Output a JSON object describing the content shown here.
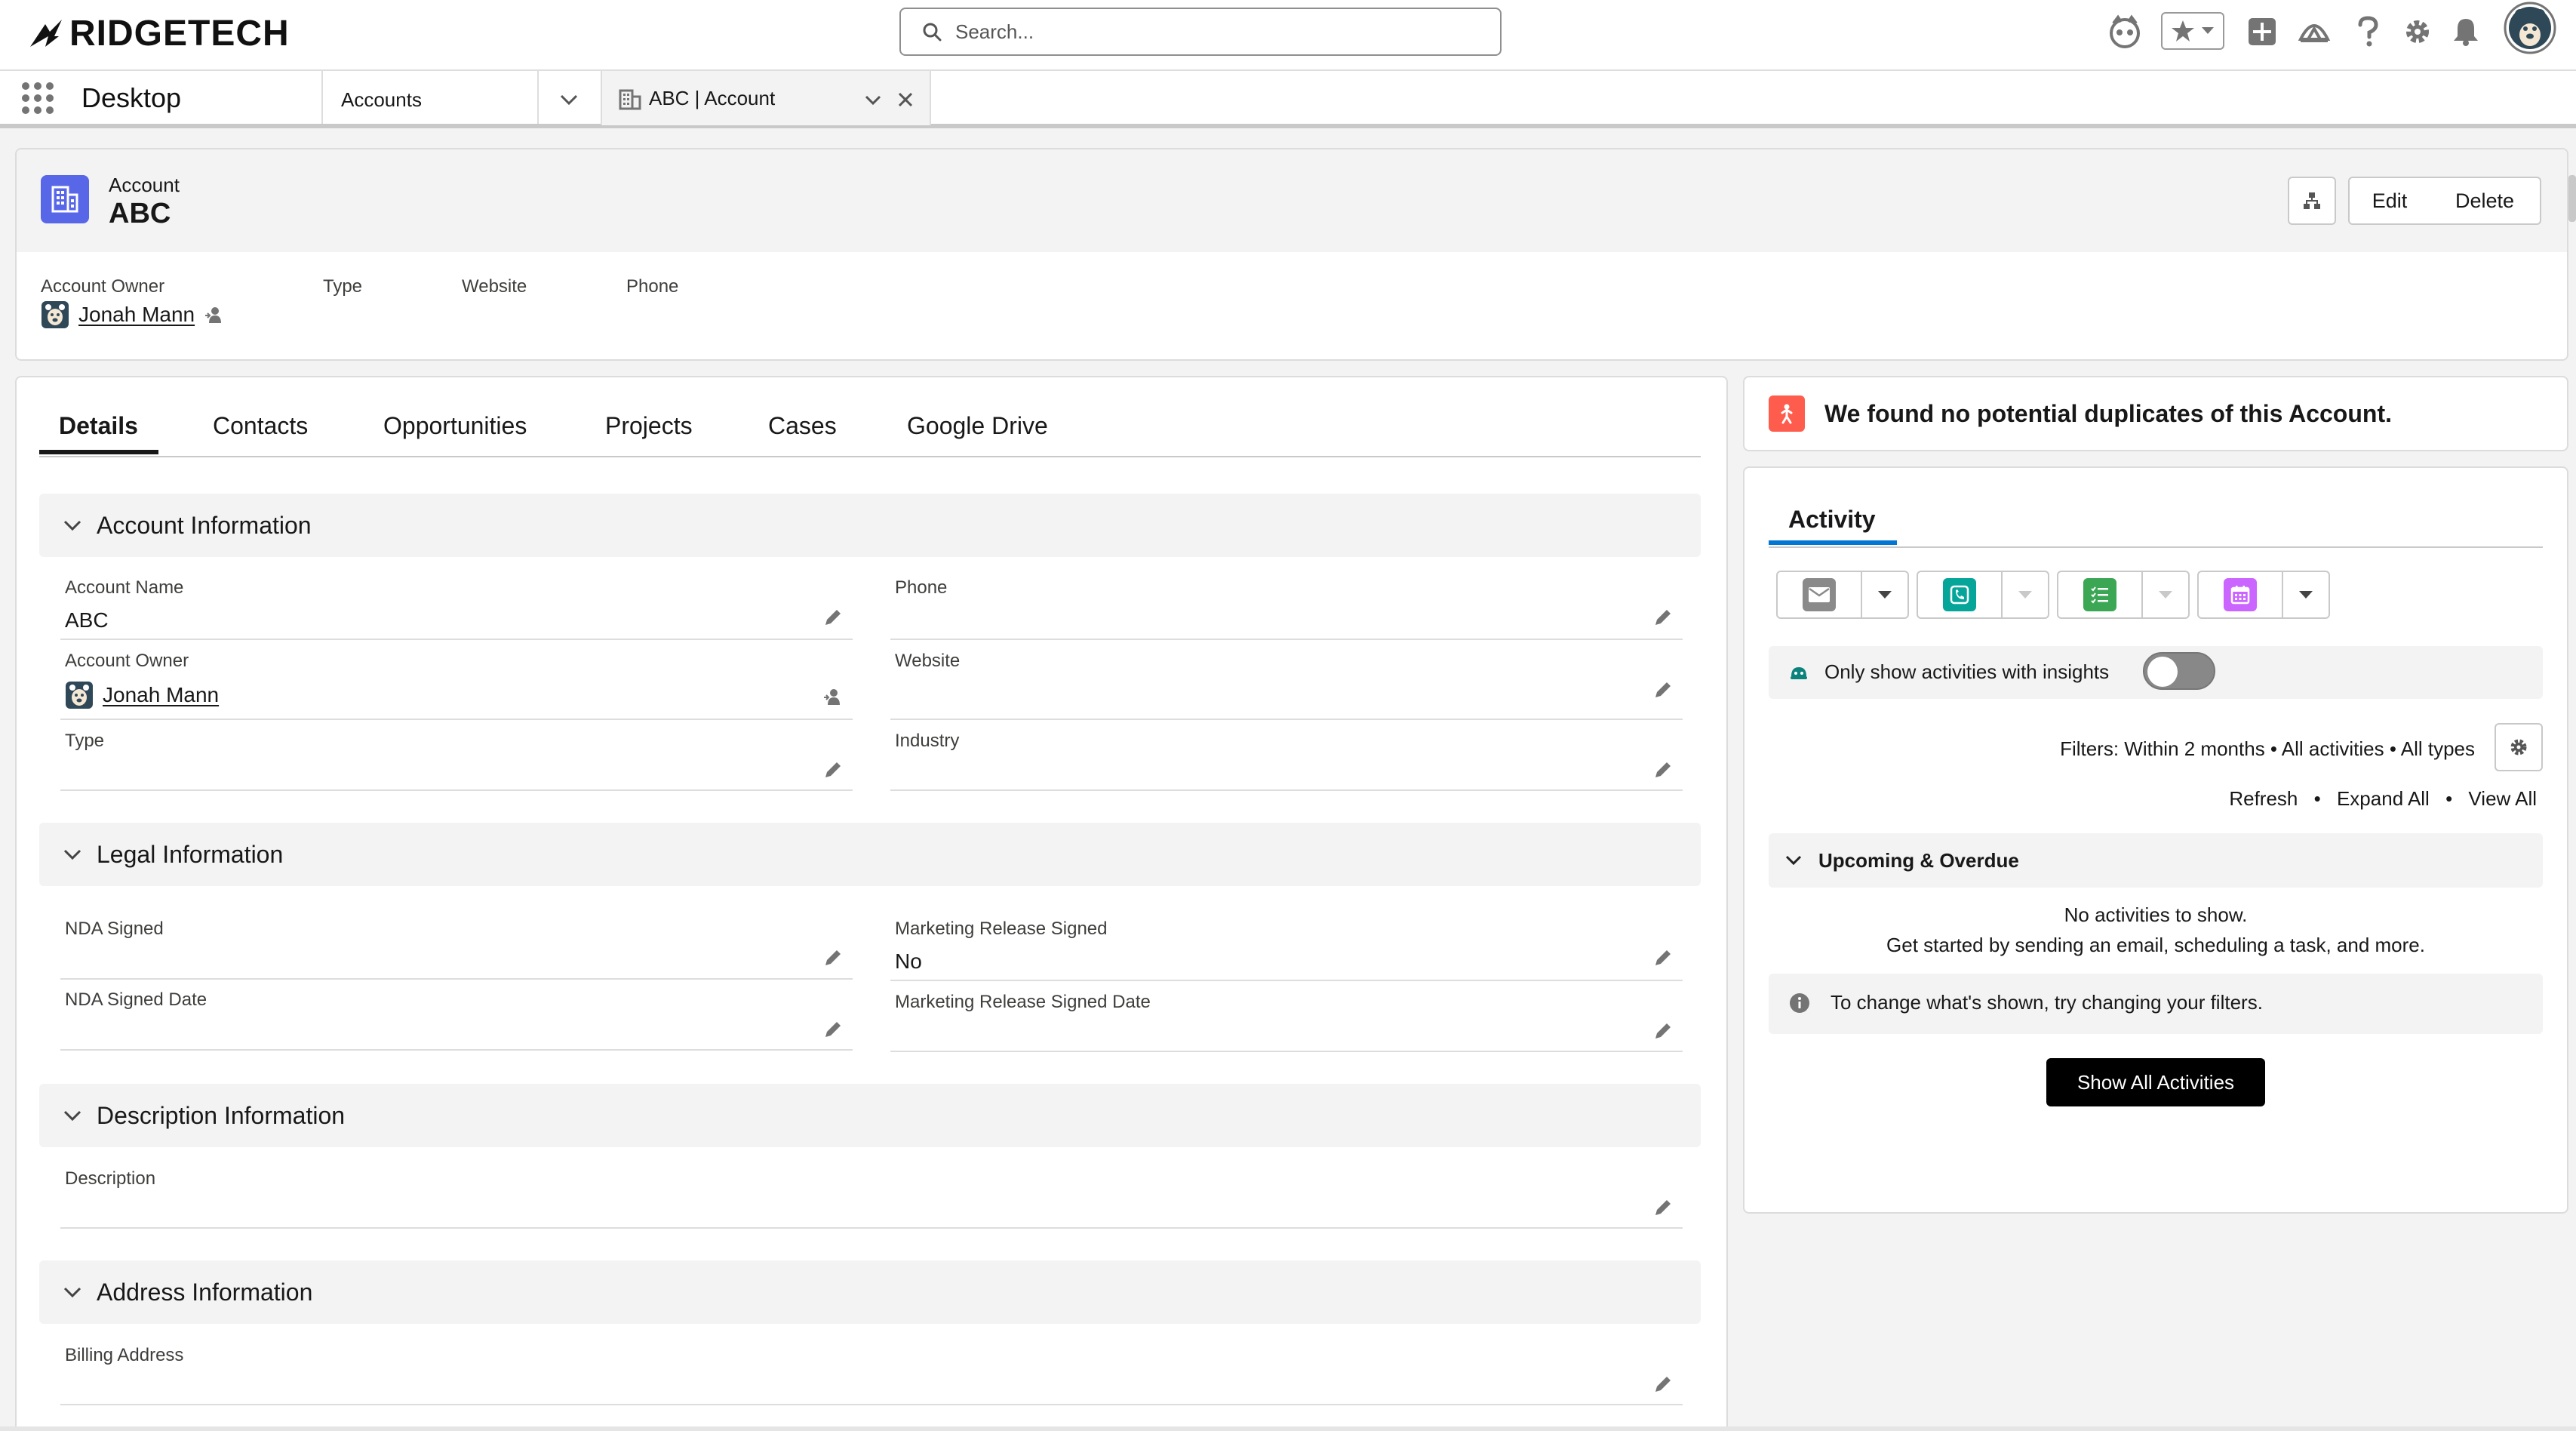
{
  "global_header": {
    "logo_text": "RIDGETECH",
    "search_placeholder": "Search...",
    "icons": [
      "agent-icon",
      "favorites-star-icon",
      "favorites-chevron-icon",
      "add-icon",
      "trailhead-icon",
      "help-icon",
      "setup-gear-icon",
      "notifications-bell-icon",
      "user-avatar"
    ]
  },
  "nav": {
    "app_name": "Desktop",
    "object_tab": "Accounts",
    "active_tab": "ABC | Account"
  },
  "record": {
    "type_label": "Account",
    "name": "ABC",
    "buttons": {
      "edit": "Edit",
      "delete": "Delete"
    },
    "highlights": {
      "owner_label": "Account Owner",
      "owner_value": "Jonah Mann",
      "type_label": "Type",
      "website_label": "Website",
      "phone_label": "Phone"
    }
  },
  "tabs": [
    "Details",
    "Contacts",
    "Opportunities",
    "Projects",
    "Cases",
    "Google Drive"
  ],
  "sections": {
    "account_info": {
      "title": "Account Information",
      "account_name_label": "Account Name",
      "account_name_value": "ABC",
      "phone_label": "Phone",
      "owner_label": "Account Owner",
      "owner_value": "Jonah Mann",
      "website_label": "Website",
      "type_label": "Type",
      "industry_label": "Industry"
    },
    "legal_info": {
      "title": "Legal Information",
      "nda_signed_label": "NDA Signed",
      "marketing_release_label": "Marketing Release Signed",
      "marketing_release_value": "No",
      "nda_date_label": "NDA Signed Date",
      "marketing_date_label": "Marketing Release Signed Date"
    },
    "description_info": {
      "title": "Description Information",
      "description_label": "Description"
    },
    "address_info": {
      "title": "Address Information",
      "billing_label": "Billing Address"
    }
  },
  "duplicates": {
    "message": "We found no potential duplicates of this Account."
  },
  "activity": {
    "title": "Activity",
    "insights_label": "Only show activities with insights",
    "insights_on": false,
    "filters_text": "Filters: Within 2 months • All activities • All types",
    "links": {
      "refresh": "Refresh",
      "expand_all": "Expand All",
      "view_all": "View All",
      "separator": "•"
    },
    "upcoming_label": "Upcoming & Overdue",
    "empty_line1": "No activities to show.",
    "empty_line2": "Get started by sending an email, scheduling a task, and more.",
    "filter_hint": "To change what's shown, try changing your filters.",
    "show_all_label": "Show All Activities"
  },
  "colors": {
    "account_icon": "#5867e8",
    "duplicate_icon": "#fe5c4c",
    "email": "#8a8a8a",
    "call": "#06a59a",
    "task": "#3ba755",
    "event": "#cb65ff",
    "activity_accent": "#0176d3"
  }
}
